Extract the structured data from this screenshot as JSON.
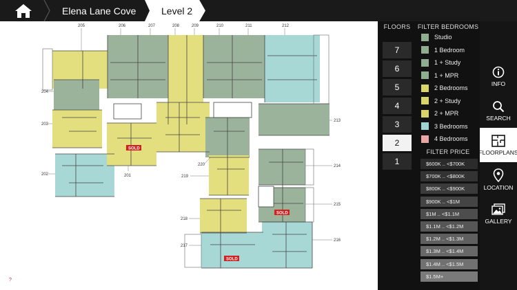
{
  "header": {
    "home_icon": "home-icon",
    "breadcrumb": [
      "Elena Lane Cove",
      "Level 2"
    ]
  },
  "floors": {
    "title": "FLOORS",
    "items": [
      "7",
      "6",
      "5",
      "4",
      "3",
      "2",
      "1"
    ],
    "active": "2"
  },
  "filter_bedrooms": {
    "title": "FILTER BEDROOMS",
    "items": [
      {
        "label": "Studio",
        "color": "#8fad8f"
      },
      {
        "label": "1 Bedroom",
        "color": "#8fad8f"
      },
      {
        "label": "1 + Study",
        "color": "#8fad8f"
      },
      {
        "label": "1 + MPR",
        "color": "#8fad8f"
      },
      {
        "label": "2 Bedrooms",
        "color": "#d9d56a"
      },
      {
        "label": "2 + Study",
        "color": "#d9d56a"
      },
      {
        "label": "2 + MPR",
        "color": "#d9d56a"
      },
      {
        "label": "3 Bedrooms",
        "color": "#9fd3d3"
      },
      {
        "label": "4 Bedrooms",
        "color": "#e7a5a5"
      }
    ]
  },
  "filter_price": {
    "title": "FILTER PRICE",
    "items": [
      "$600K .. <$700K",
      "$700K .. <$800K",
      "$800K .. <$900K",
      "$900K .. <$1M",
      "$1M .. <$1.1M",
      "$1.1M .. <$1.2M",
      "$1.2M .. <$1.3M",
      "$1.3M .. <$1.4M",
      "$1.4M .. <$1.5M",
      "$1.5M+"
    ]
  },
  "nav": {
    "items": [
      {
        "label": "INFO",
        "icon": "info-icon"
      },
      {
        "label": "SEARCH",
        "icon": "search-icon"
      },
      {
        "label": "FLOORPLANS",
        "icon": "floorplan-icon"
      },
      {
        "label": "LOCATION",
        "icon": "location-pin-icon"
      },
      {
        "label": "GALLERY",
        "icon": "gallery-icon"
      }
    ],
    "active": "FLOORPLANS"
  },
  "plan": {
    "units": [
      "205",
      "206",
      "207",
      "208",
      "209",
      "210",
      "211",
      "212",
      "204",
      "203",
      "213",
      "202",
      "201",
      "220",
      "214",
      "219",
      "215",
      "218",
      "217",
      "216"
    ],
    "sold_label": "SOLD",
    "help_mark": "?"
  }
}
